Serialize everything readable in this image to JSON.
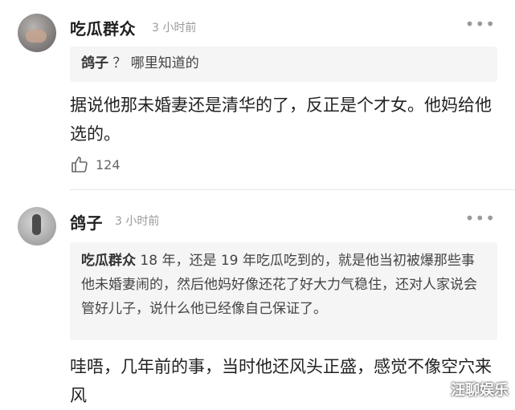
{
  "comments": [
    {
      "name": "吃瓜群众",
      "time": "3 小时前",
      "more": "•••",
      "quote": {
        "name": "鸽子",
        "text": "？ 哪里知道的"
      },
      "body": "据说他那未婚妻还是清华的了，反正是个才女。他妈给他选的。",
      "likes": "124"
    },
    {
      "name": "鸽子",
      "time": "3 小时前",
      "more": "•••",
      "quote": {
        "name": "吃瓜群众",
        "text": "18 年，还是 19 年吃瓜吃到的，就是他当初被爆那些事他未婚妻闹的，然后他妈好像还花了好大力气稳住，还对人家说会管好儿子，说什么他已经像自己保证了。"
      },
      "body": "哇唔，几年前的事，当时他还风头正盛，感觉不像空穴来风"
    }
  ],
  "watermark": "汪聊娱乐"
}
